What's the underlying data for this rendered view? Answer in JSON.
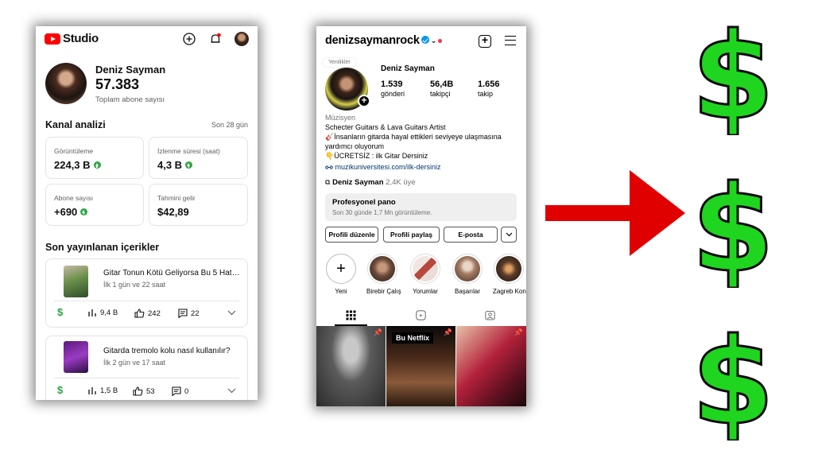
{
  "youtube_studio": {
    "brand": "Studio",
    "channel_name": "Deniz Sayman",
    "subscribers": "57.383",
    "subscribers_label": "Toplam abone sayısı",
    "analytics_title": "Kanal analizi",
    "period": "Son 28 gün",
    "cards": [
      {
        "label": "Görüntüleme",
        "value": "224,3 B"
      },
      {
        "label": "İzlenme süresi (saat)",
        "value": "4,3 B"
      },
      {
        "label": "Abone sayısı",
        "value": "+690"
      },
      {
        "label": "Tahmini gelir",
        "value": "$42,89"
      }
    ],
    "recent_title": "Son yayınlanan içerikler",
    "videos": [
      {
        "title": "Gitar Tonun Kötü Geliyorsa Bu 5 Hat…",
        "age": "İlk 1 gün ve 22 saat",
        "views": "9,4 B",
        "likes": "242",
        "comments": "22"
      },
      {
        "title": "Gitarda tremolo kolu nasıl kullanılır?",
        "age": "İlk 2 gün ve 17 saat",
        "views": "1,5 B",
        "likes": "53",
        "comments": "0"
      }
    ],
    "currency_symbol": "$"
  },
  "instagram": {
    "username": "denizsaymanrock",
    "note_bubble": "Yenilikler",
    "display_name": "Deniz Sayman",
    "stats": [
      {
        "value": "1.539",
        "label": "gönderi"
      },
      {
        "value": "56,4B",
        "label": "takipçi"
      },
      {
        "value": "1.656",
        "label": "takip"
      }
    ],
    "category": "Müzisyen",
    "bio_lines": [
      "Schecter Guitars & Lava Guitars Artist",
      "🎸İnsanların gitarda hayal ettikleri seviyeye ulaşmasına",
      "yardımcı oluyorum",
      "👇ÜCRETSİZ : ilk Gitar Dersiniz"
    ],
    "link": "muzikuniversitesi.com/ilk-dersiniz",
    "threads_name": "Deniz Sayman",
    "threads_count": "2,4K üye",
    "pro_panel_title": "Profesyonel pano",
    "pro_panel_sub": "Son 30 günde 1,7 Mn görüntüleme.",
    "buttons": {
      "edit": "Profili düzenle",
      "share": "Profili paylaş",
      "email": "E-posta"
    },
    "highlights": [
      {
        "label": "Yeni",
        "color": "#ffffff"
      },
      {
        "label": "Birebir Çalış",
        "color": "#6b4a3a"
      },
      {
        "label": "Yorumlar",
        "color": "#b8473d"
      },
      {
        "label": "Başarılar",
        "color": "#a37b63"
      },
      {
        "label": "Zagreb Kon",
        "color": "#5a3b2a"
      }
    ],
    "posts": [
      {
        "overlay": ""
      },
      {
        "overlay": "Bu Netflix"
      },
      {
        "overlay": ""
      }
    ]
  },
  "decor": {
    "arrow_color": "#e00000",
    "dollar_color": "#1fd51f",
    "dollar_symbol": "$"
  }
}
